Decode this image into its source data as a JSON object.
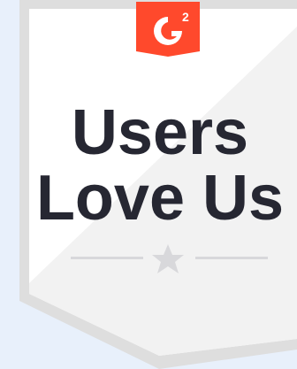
{
  "badge": {
    "brand": "G2",
    "logo_superscript": "2",
    "title_line1": "Users",
    "title_line2": "Love Us",
    "icons": [
      "g2-logo-icon",
      "star-icon"
    ],
    "colors": {
      "background": "#e8f0fb",
      "shield_outer": "#dedede",
      "shield_inner": "#ffffff",
      "shield_shade": "#f2f2f2",
      "logo_red": "#ff492c",
      "text": "#262732",
      "accent_gray": "#d8d8db"
    }
  }
}
